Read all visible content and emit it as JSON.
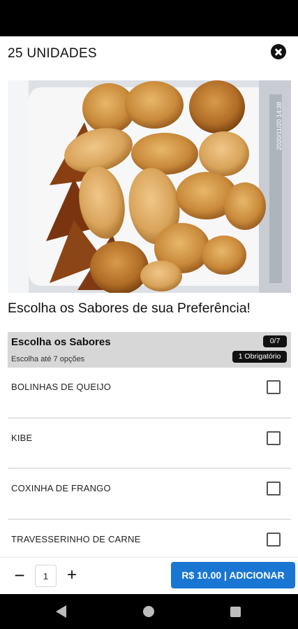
{
  "header": {
    "title": "25 UNIDADES",
    "close_icon": "close-circle-icon"
  },
  "product": {
    "image": "fried-snacks-photo",
    "photo_timestamp": "2020/11/20 14:38",
    "subtitle": "Escolha os Sabores de sua Preferência!"
  },
  "group": {
    "title": "Escolha os Sabores",
    "hint": "Escolha até 7 opções",
    "count_badge": "0/7",
    "required_badge": "1 Obrigatório"
  },
  "options": [
    {
      "label": "BOLINHAS DE QUEIJO",
      "checked": false
    },
    {
      "label": "KIBE",
      "checked": false
    },
    {
      "label": "COXINHA DE FRANGO",
      "checked": false
    },
    {
      "label": "TRAVESSERINHO DE CARNE",
      "checked": false
    }
  ],
  "footer": {
    "minus_label": "−",
    "quantity": "1",
    "plus_label": "+",
    "add_label": "R$ 10.00 | ADICIONAR"
  },
  "colors": {
    "primary": "#1976d2",
    "group_bg": "#d7d7d7",
    "badge_bg": "#111111"
  },
  "nav": {
    "back_icon": "nav-back-icon",
    "home_icon": "nav-home-icon",
    "recents_icon": "nav-recents-icon"
  }
}
